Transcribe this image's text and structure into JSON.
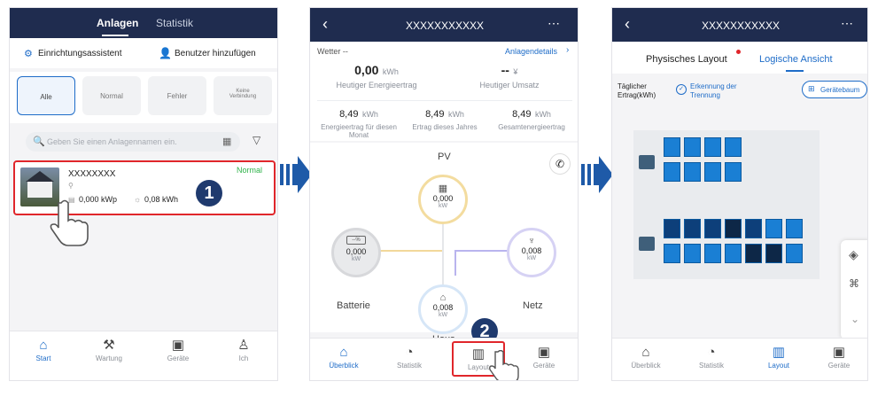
{
  "screen1": {
    "tabs": [
      "Anlagen",
      "Statistik"
    ],
    "wizard_label": "Einrichtungsassistent",
    "add_user_label": "Benutzer hinzufügen",
    "filters": [
      "Alle",
      "Normal",
      "Fehler",
      "Keine Verbindung"
    ],
    "search_placeholder": "Geben Sie einen Anlagennamen ein.",
    "plant": {
      "name": "XXXXXXXX",
      "status": "Normal",
      "capacity": "0,000 kWp",
      "yield": "0,08 kWh"
    },
    "step_number": "1",
    "tabbar": [
      "Start",
      "Wartung",
      "Geräte",
      "Ich"
    ]
  },
  "screen2": {
    "title": "XXXXXXXXXXX",
    "weather": "Wetter --",
    "details_link": "Anlagendetails",
    "today_yield": {
      "value": "0,00",
      "unit": "kWh",
      "label": "Heutiger Energieertrag"
    },
    "today_revenue": {
      "value": "--",
      "unit": "¥",
      "label": "Heutiger Umsatz"
    },
    "stats": [
      {
        "value": "8,49",
        "unit": "kWh",
        "label": "Energieertrag für diesen Monat"
      },
      {
        "value": "8,49",
        "unit": "kWh",
        "label": "Ertrag dieses Jahres"
      },
      {
        "value": "8,49",
        "unit": "kWh",
        "label": "Gesamtenergieertrag"
      }
    ],
    "flow": {
      "pv": {
        "label": "PV",
        "value": "0,000",
        "unit": "kW"
      },
      "battery": {
        "label": "Batterie",
        "value": "0,000",
        "unit": "kW",
        "soc": "--%"
      },
      "grid": {
        "label": "Netz",
        "value": "0,008",
        "unit": "kW"
      },
      "house": {
        "label": "Haus",
        "value": "0,008",
        "unit": "kW"
      }
    },
    "step_number": "2",
    "tabbar": [
      "Überblick",
      "Statistik",
      "Layout",
      "Geräte"
    ]
  },
  "screen3": {
    "title": "XXXXXXXXXXX",
    "tabs": [
      "Physisches Layout",
      "Logische Ansicht"
    ],
    "daily_yield_label": "Täglicher Ertrag(kWh)",
    "detection_label": "Erkennung der Trennung",
    "device_tree_label": "Gerätebaum",
    "tabbar": [
      "Überblick",
      "Statistik",
      "Layout",
      "Geräte"
    ]
  },
  "colors": {
    "navy": "#1f2c4f",
    "accent": "#1e6cc8",
    "highlight": "#e0262b",
    "status_green": "#2fb34a"
  }
}
